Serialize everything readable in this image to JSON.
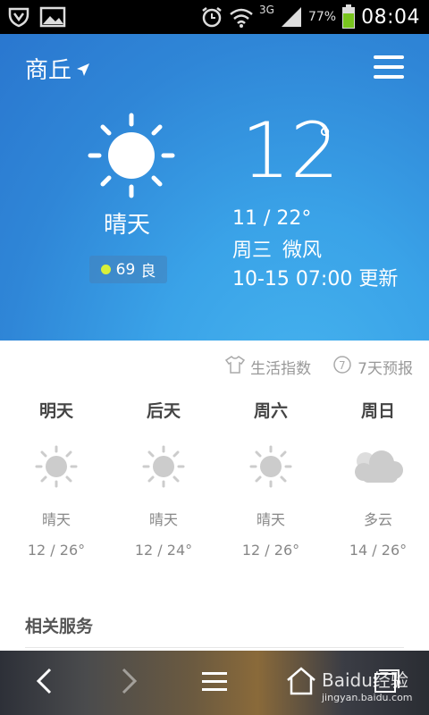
{
  "status": {
    "network": "3G",
    "battery": "77%",
    "time": "08:04"
  },
  "hero": {
    "city": "商丘",
    "temperature": "12",
    "degree_symbol": "°",
    "condition": "晴天",
    "aqi_value": "69",
    "aqi_label": "良",
    "temp_range": "11 / 22°",
    "weekday": "周三",
    "wind": "微风",
    "update_time": "10-15 07:00 更新"
  },
  "links": {
    "life_index": "生活指数",
    "seven_day": "7天预报"
  },
  "forecast": [
    {
      "day": "明天",
      "condition": "晴天",
      "temp": "12 / 26°",
      "icon": "sun"
    },
    {
      "day": "后天",
      "condition": "晴天",
      "temp": "12 / 24°",
      "icon": "sun"
    },
    {
      "day": "周六",
      "condition": "晴天",
      "temp": "12 / 26°",
      "icon": "sun"
    },
    {
      "day": "周日",
      "condition": "多云",
      "temp": "14 / 26°",
      "icon": "cloud"
    }
  ],
  "services_title": "相关服务",
  "watermark": {
    "title": "Baidu经验",
    "sub": "jingyan.baidu.com"
  },
  "colors": {
    "hero_top": "#2a77cf",
    "hero_bottom": "#46b3ee",
    "aqi_dot": "#d8f03a"
  }
}
